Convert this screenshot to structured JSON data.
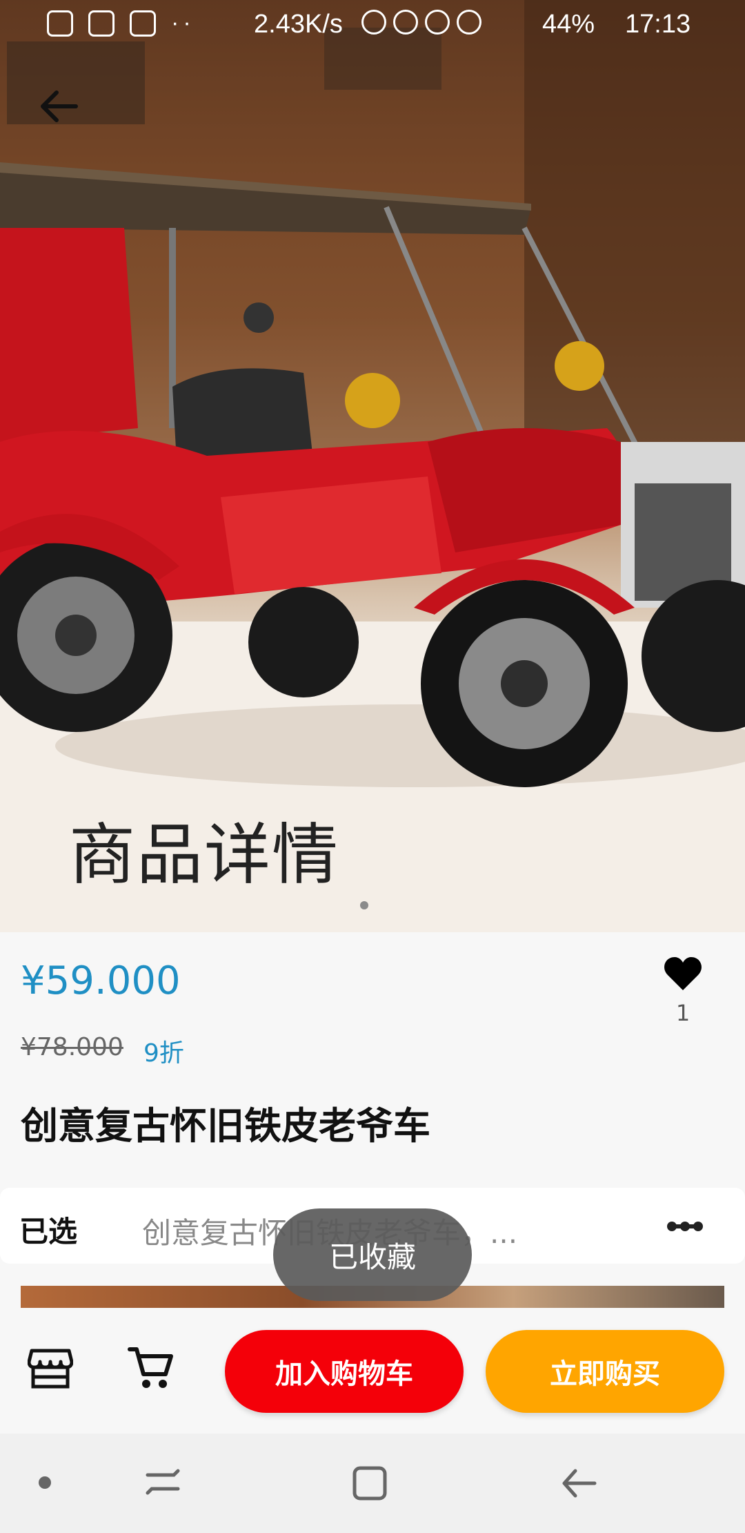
{
  "status_bar": {
    "speed": "2.43K/s",
    "battery": "44%",
    "time": "17:13",
    "dots": "··"
  },
  "hero": {
    "title": "商品详情",
    "image_alt": "vintage red tin toy car"
  },
  "product": {
    "price": "¥59.000",
    "old_price": "¥78.000",
    "discount": "9折",
    "favorite_count": "1",
    "title": "创意复古怀旧铁皮老爷车"
  },
  "selection": {
    "label": "已选",
    "value": "创意复古怀旧铁皮老爷车，..."
  },
  "toast": {
    "text": "已收藏"
  },
  "actions": {
    "add_to_cart": "加入购物车",
    "buy_now": "立即购买"
  },
  "colors": {
    "accent_blue": "#1f8fc4",
    "cart_red": "#f40009",
    "buy_orange": "#ffa500"
  }
}
